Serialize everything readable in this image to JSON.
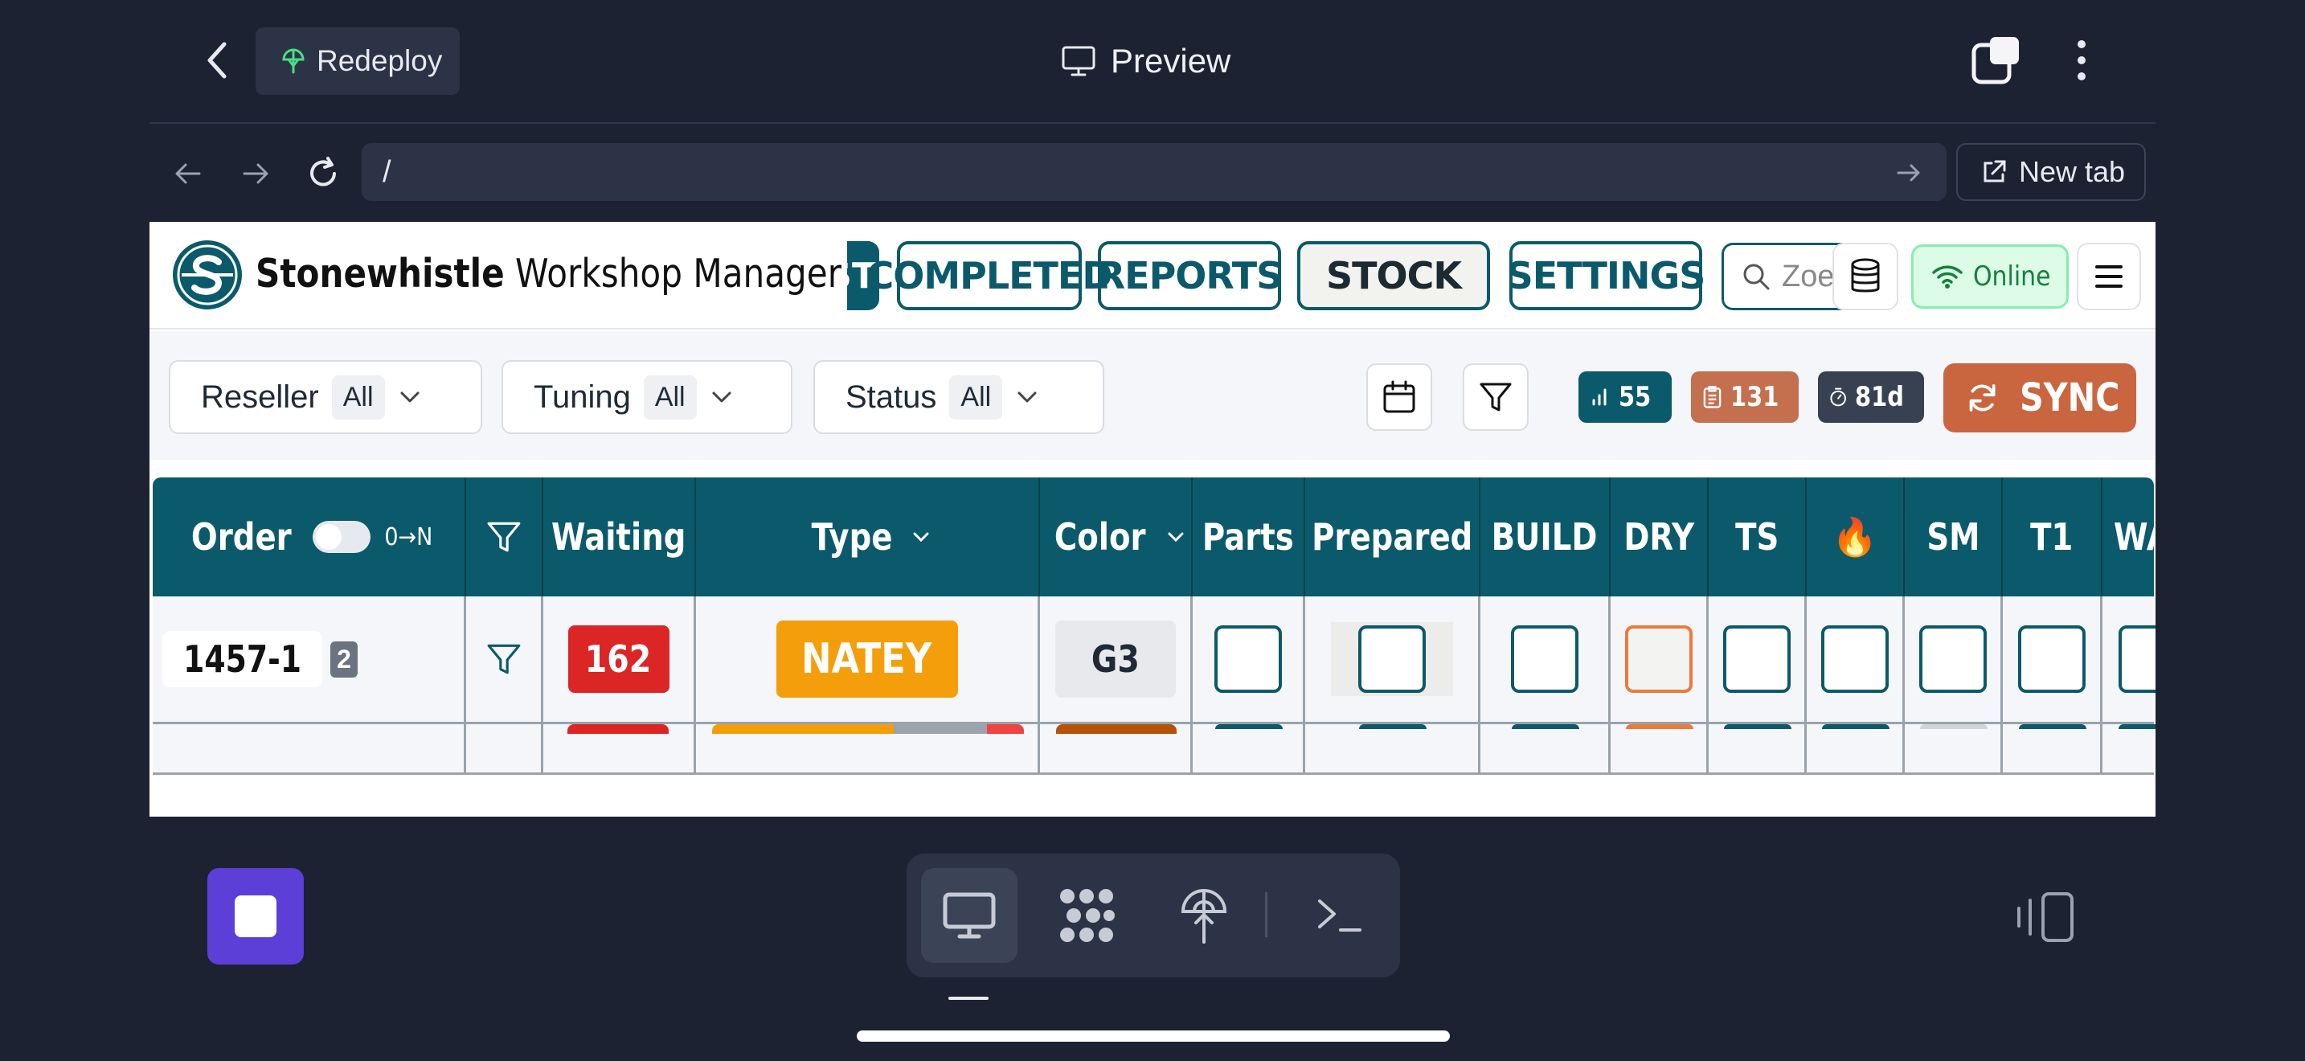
{
  "topbar": {
    "redeploy_label": "Redeploy",
    "title": "Preview"
  },
  "urlbar": {
    "url": "/",
    "new_tab_label": "New tab"
  },
  "app": {
    "brand_bold": "Stonewhistle",
    "brand_rest": " Workshop Manager",
    "nav": {
      "partial": "ST",
      "completed": "COMPLETED",
      "reports": "REPORTS",
      "stock": "STOCK",
      "settings": "SETTINGS"
    },
    "search_placeholder": "Zoe",
    "status": "Online"
  },
  "filters": {
    "reseller": {
      "label": "Reseller",
      "value": "All"
    },
    "tuning": {
      "label": "Tuning",
      "value": "All"
    },
    "status": {
      "label": "Status",
      "value": "All"
    }
  },
  "stats": {
    "count": "55",
    "orders": "131",
    "days": "81d"
  },
  "sync_label": "SYNC",
  "table": {
    "columns": {
      "order": "Order",
      "sort": "0→N",
      "waiting": "Waiting",
      "type": "Type",
      "color": "Color",
      "parts": "Parts",
      "prepared": "Prepared",
      "build": "BUILD",
      "dry": "DRY",
      "ts": "TS",
      "fire": "🔥",
      "sm": "SM",
      "t1": "T1",
      "wa": "WA"
    },
    "rows": [
      {
        "order": "1457-1",
        "count": "2",
        "waiting": "162",
        "type": "NATEY",
        "color": "G3"
      }
    ]
  },
  "colors": {
    "primary": "#0b5a6b",
    "waiting_red": "#dc2626",
    "type_amber": "#f59e0b",
    "sync_orange": "#c9663f",
    "online_green": "#15803d",
    "stop_purple": "#5b3fd6"
  }
}
